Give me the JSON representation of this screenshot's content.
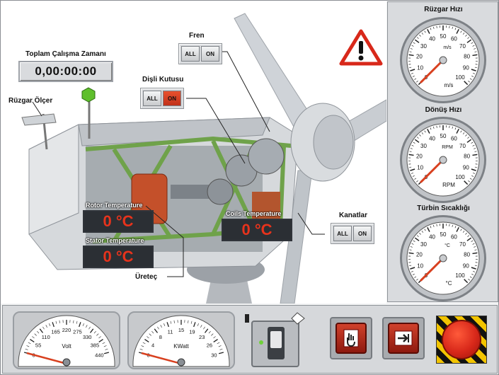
{
  "scene": {
    "runtime_label": "Toplam Çalışma Zamanı",
    "runtime_value": "0,00:00:00",
    "wind_meter_label": "Rüzgar Ölçer",
    "generator_label": "Üreteç",
    "brake": {
      "label": "Fren",
      "all": "ALL",
      "on": "ON",
      "state": "off"
    },
    "gearbox": {
      "label": "Dişli Kutusu",
      "all": "ALL",
      "on": "ON",
      "state": "on"
    },
    "blades": {
      "label": "Kanatlar",
      "all": "ALL",
      "on": "ON",
      "state": "off"
    },
    "rotor_temp": {
      "label": "Rotor Temperature",
      "value": "0 °C"
    },
    "stator_temp": {
      "label": "Stator Temperature",
      "value": "0 °C"
    },
    "coils_temp": {
      "label": "Coils Temperature",
      "value": "0 °C"
    },
    "colors": {
      "accent_red": "#e7331c",
      "frame_green": "#6fa24a",
      "status_led": "#5fbf2c"
    }
  },
  "gauges": [
    {
      "title": "Rüzgar Hızı",
      "unit_top": "m/s",
      "unit_bottom": "m/s",
      "ticks": [
        "0",
        "10",
        "20",
        "30",
        "40",
        "50",
        "60",
        "70",
        "80",
        "90",
        "100"
      ],
      "value": 0
    },
    {
      "title": "Dönüş Hızı",
      "unit_top": "RPM",
      "unit_bottom": "RPM",
      "ticks": [
        "0",
        "10",
        "20",
        "30",
        "40",
        "50",
        "60",
        "70",
        "80",
        "90",
        "100"
      ],
      "value": 0
    },
    {
      "title": "Türbin Sıcaklığı",
      "unit_top": "°C",
      "unit_bottom": "°C",
      "ticks": [
        "0",
        "10",
        "20",
        "30",
        "40",
        "50",
        "60",
        "70",
        "80",
        "90",
        "100"
      ],
      "value": 0
    }
  ],
  "meters": [
    {
      "unit": "Volt",
      "ticks": [
        "0",
        "55",
        "110",
        "165",
        "220",
        "275",
        "330",
        "385",
        "440"
      ],
      "value": 0
    },
    {
      "unit": "KWatt",
      "ticks": [
        "0",
        "4",
        "8",
        "11",
        "15",
        "19",
        "23",
        "26",
        "30"
      ],
      "value": 0
    }
  ],
  "controls": {
    "switch_icon": "hand-toggle-switch-icon",
    "manual_icon": "hand-press-icon",
    "exit_icon": "arrow-exit-icon",
    "estop_icon": "emergency-stop-icon"
  }
}
